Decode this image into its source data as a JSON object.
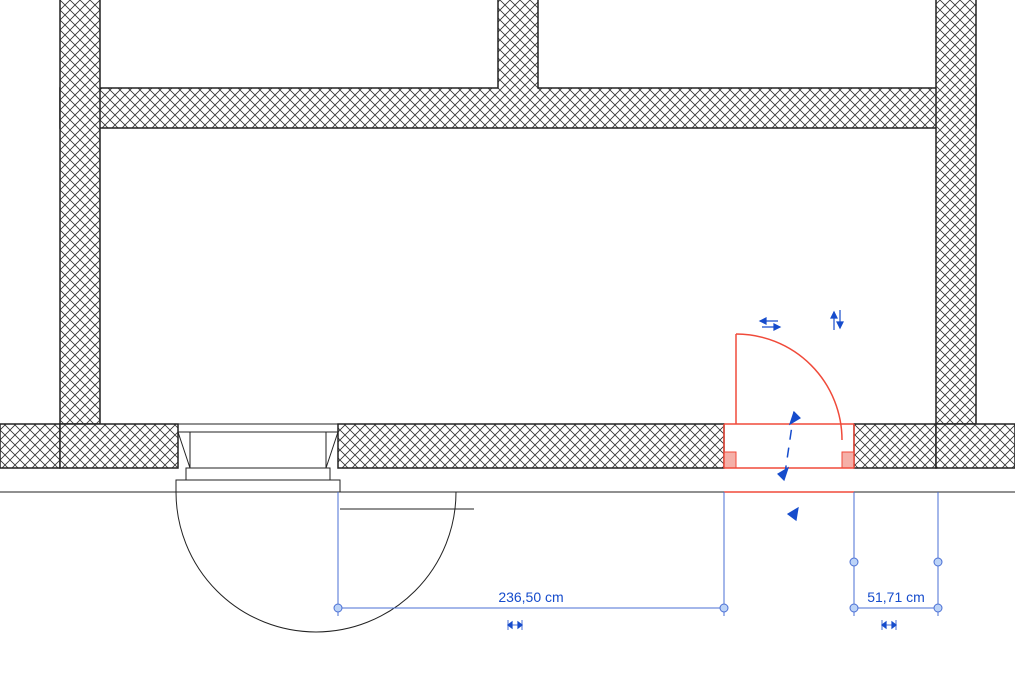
{
  "dimensions": {
    "left": {
      "value": "236,50 cm"
    },
    "right": {
      "value": "51,71 cm"
    }
  },
  "door": {
    "selected": true,
    "swing": 90
  }
}
